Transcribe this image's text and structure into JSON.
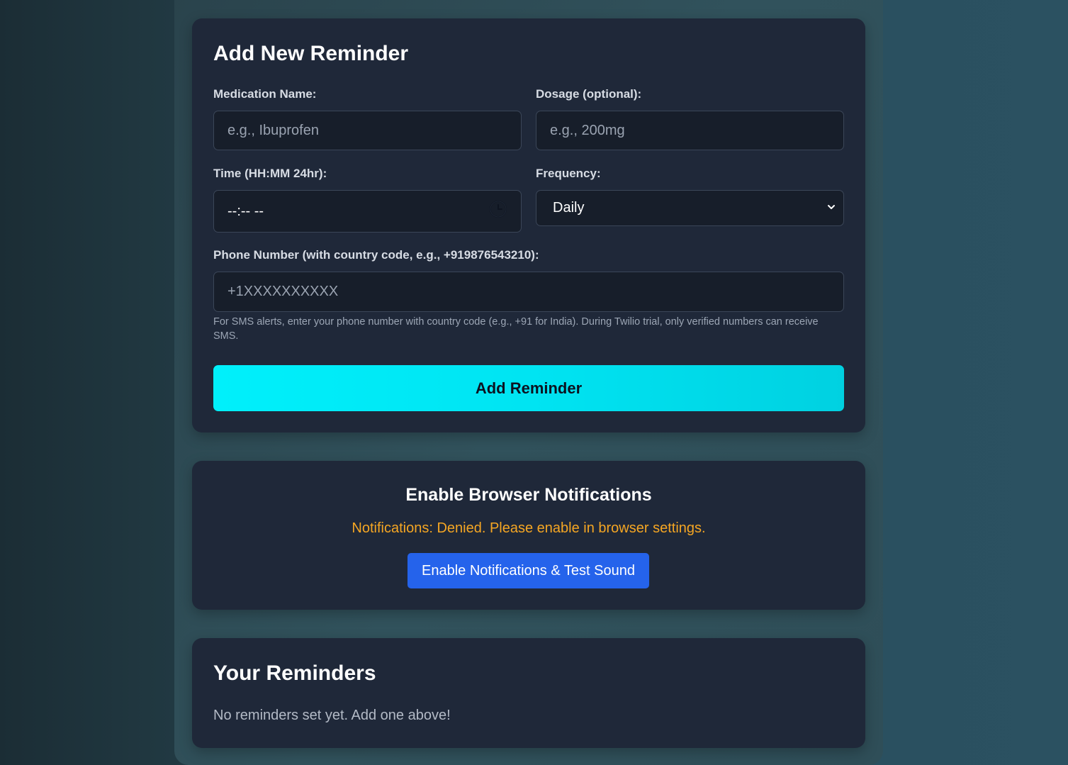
{
  "form": {
    "title": "Add New Reminder",
    "medication_label": "Medication Name:",
    "medication_placeholder": "e.g., Ibuprofen",
    "dosage_label": "Dosage (optional):",
    "dosage_placeholder": "e.g., 200mg",
    "time_label": "Time (HH:MM 24hr):",
    "time_value": "--:-- --",
    "time_icon": "clock-icon",
    "frequency_label": "Frequency:",
    "frequency_value": "Daily",
    "frequency_icon": "chevron-down-icon",
    "phone_label": "Phone Number (with country code, e.g., +919876543210):",
    "phone_placeholder": "+1XXXXXXXXXX",
    "phone_hint": "For SMS alerts, enter your phone number with country code (e.g., +91 for India). During Twilio trial, only verified numbers can receive SMS.",
    "submit_label": "Add Reminder"
  },
  "notifications": {
    "title": "Enable Browser Notifications",
    "status": "Notifications: Denied. Please enable in browser settings.",
    "button_label": "Enable Notifications & Test Sound"
  },
  "reminders": {
    "title": "Your Reminders",
    "empty_text": "No reminders set yet. Add one above!"
  },
  "colors": {
    "card_bg": "#1f2839",
    "accent_cyan": "#00e4f2",
    "button_blue": "#2563eb",
    "warning_orange": "#f5a623"
  }
}
